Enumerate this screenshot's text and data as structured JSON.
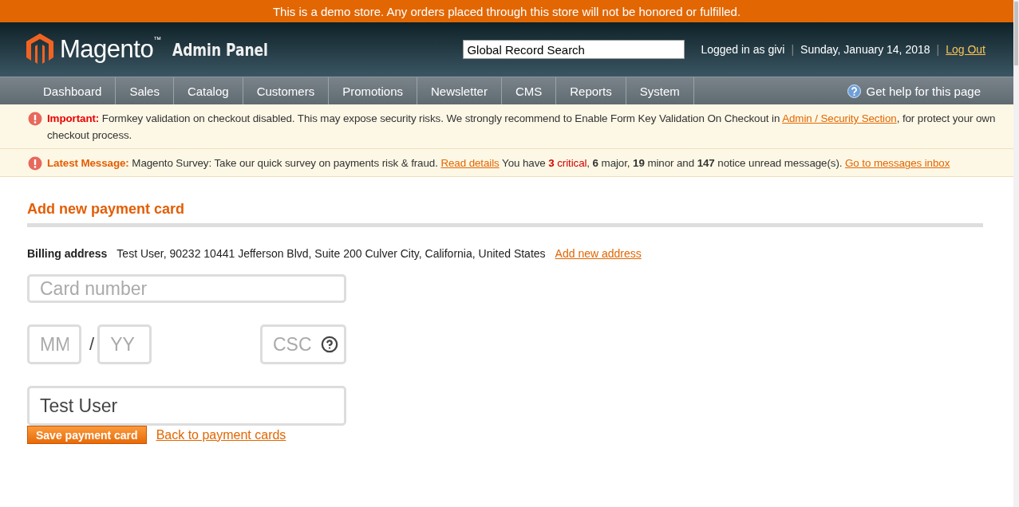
{
  "demo_banner": "This is a demo store. Any orders placed through this store will not be honored or fulfilled.",
  "header": {
    "logo_word": "Magento",
    "logo_mark": "™",
    "logo_suffix": "Admin Panel",
    "search": {
      "value": "Global Record Search"
    },
    "user": "Logged in as givi",
    "separators": [
      "|",
      "|"
    ],
    "date": "Sunday, January 14, 2018",
    "logout": "Log Out"
  },
  "nav": {
    "items": [
      {
        "label": "Dashboard",
        "selected": false
      },
      {
        "label": "Sales",
        "selected": false
      },
      {
        "label": "Catalog",
        "selected": false
      },
      {
        "label": "Customers",
        "selected": false
      },
      {
        "label": "Promotions",
        "selected": false
      },
      {
        "label": "Newsletter",
        "selected": false
      },
      {
        "label": "CMS",
        "selected": false
      },
      {
        "label": "Reports",
        "selected": false
      },
      {
        "label": "System",
        "selected": false
      }
    ],
    "help": "Get help for this page"
  },
  "notices": [
    {
      "kind": "important",
      "title": "Important:",
      "text": "Formkey validation on checkout disabled. This may expose security risks. We strongly recommend to Enable Form Key Validation On Checkout in",
      "link": "Admin / Security Section",
      "after": ", for protect your own checkout process."
    },
    {
      "kind": "latest",
      "title": "Latest Message:",
      "text": "Magento Survey: Take our quick survey on payments risk & fraud.",
      "link": "Read details",
      "summary": [
        {
          "kind": "plain",
          "text": "You have"
        },
        {
          "kind": "critical",
          "text": "**3** critical"
        },
        {
          "kind": "plain",
          "text": ", **6** major, **19** minor and **147** notice unread message(s)."
        }
      ],
      "link2": "Go to messages inbox"
    }
  ],
  "page": {
    "title": "Add new payment card",
    "billing_label": "Billing address",
    "billing_value": "Test User, 90232 10441 Jefferson Blvd, Suite 200 Culver City, California, United States",
    "add_address": "Add new address",
    "card_number": {
      "placeholder": "Card number"
    },
    "month": {
      "placeholder": "MM"
    },
    "separator": "/",
    "year": {
      "placeholder": "YY"
    },
    "csc": {
      "placeholder": "CSC"
    },
    "holder": {
      "value": "Test User"
    },
    "save": "Save payment card",
    "back": "Back to payment cards"
  }
}
